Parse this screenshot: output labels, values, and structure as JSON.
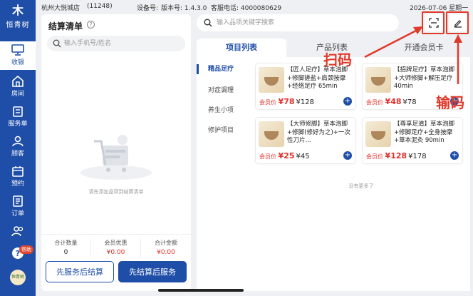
{
  "sidebar": {
    "logo_text": "恒青树",
    "items": [
      {
        "label": "收银",
        "icon": "cashier-icon",
        "active": true
      },
      {
        "label": "房间",
        "icon": "home-icon"
      },
      {
        "label": "服务单",
        "icon": "order-icon"
      },
      {
        "label": "顾客",
        "icon": "user-icon"
      },
      {
        "label": "预约",
        "icon": "calendar-icon"
      },
      {
        "label": "订单",
        "icon": "list-icon"
      },
      {
        "label": "",
        "icon": "users-icon"
      }
    ],
    "help_badge": "帮助",
    "avatar_text": "恒青树"
  },
  "statusbar": {
    "store": "杭州大悦城店",
    "store_id": "(11248)",
    "device_label": "设备号:",
    "version": "版本号: 1.4.3.0",
    "hotline": "客服电话: 4000080629",
    "datetime": "2026-07-06 星期一"
  },
  "checkout": {
    "title": "结算清单",
    "search_placeholder": "输入手机号/姓名",
    "empty_text": "请先添加品项到结算清单",
    "summary": [
      {
        "label": "合计数量",
        "value": "0"
      },
      {
        "label": "会员优惠",
        "value": "¥0.00"
      },
      {
        "label": "合计金额",
        "value": "¥0.00"
      }
    ],
    "btn_serve_first": "先服务后结算",
    "btn_pay_first": "先结算后服务"
  },
  "products": {
    "search_placeholder": "输入品项关键字搜索",
    "tabs": [
      "项目列表",
      "产品列表",
      "开通会员卡"
    ],
    "categories": [
      "精品足疗",
      "对症调理",
      "养生小项",
      "修护项目"
    ],
    "member_price_label": "会员价",
    "cards": [
      {
        "title": "【匠人足疗】草本泡脚+修脚搓盐+肩颈按摩+经络足疗 65min",
        "member_price": "¥78",
        "price": "¥128"
      },
      {
        "title": "【招牌足疗】草本泡脚+大师修脚+解压足疗 40min",
        "member_price": "¥48",
        "price": "¥78"
      },
      {
        "title": "【大师修脚】草本泡脚+修脚(修好为之)+一次性刀片...",
        "member_price": "¥25",
        "price": "¥45"
      },
      {
        "title": "【尊享足道】草本泡脚+修脚足疗+全身按摩+草本泥灸 90min",
        "member_price": "¥128",
        "price": "¥178"
      }
    ],
    "no_more": "没有更多了"
  },
  "annotations": {
    "scan": "扫码",
    "code": "输码"
  },
  "colors": {
    "primary": "#1f4ea8",
    "price_red": "#e0312b",
    "annotation_red": "#e03a2a"
  }
}
